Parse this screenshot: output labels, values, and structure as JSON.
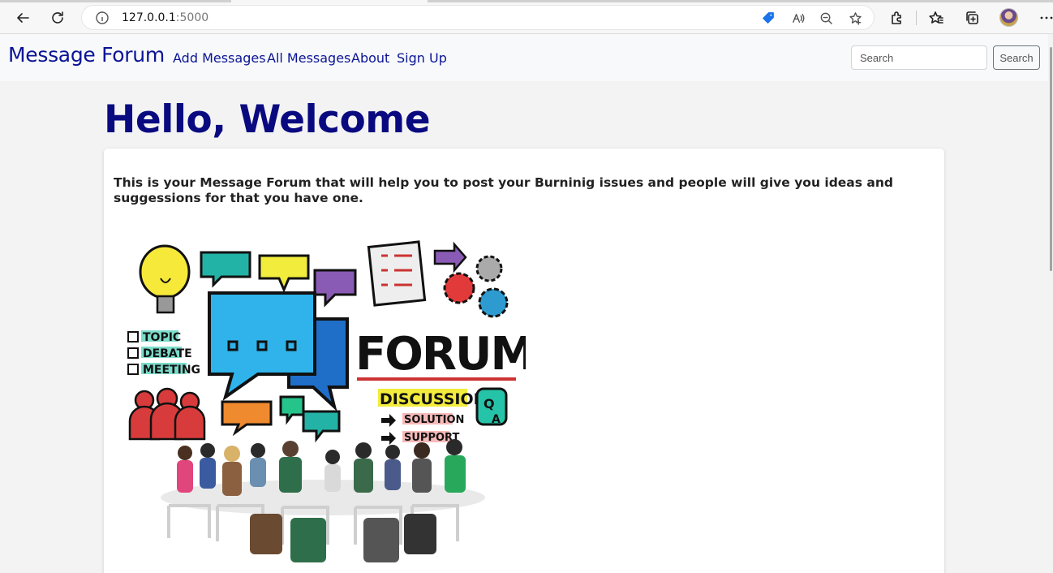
{
  "browser": {
    "url_host": "127.0.0.1",
    "url_port": ":5000"
  },
  "navbar": {
    "brand": "Message Forum",
    "links": [
      {
        "label": "Add Messages"
      },
      {
        "label": "All Messages"
      },
      {
        "label": "About"
      },
      {
        "label": "Sign Up"
      }
    ],
    "search_placeholder": "Search",
    "search_button": "Search"
  },
  "main": {
    "title": "Hello, Welcome",
    "intro": "This is your Message Forum that will help you to post your Burninig issues and people will give you ideas and suggessions for that you have one.",
    "image": {
      "forum_word": "FORUM",
      "discussion_word": "DISCUSSION",
      "list_items": [
        "TOPIC",
        "DEBATE",
        "MEETING"
      ],
      "arrow_items": [
        "SOLUTION",
        "SUPPORT"
      ],
      "qa_q": "Q",
      "qa_a": "A"
    }
  },
  "colors": {
    "brand": "#0a1496",
    "title": "#0a0a80"
  }
}
